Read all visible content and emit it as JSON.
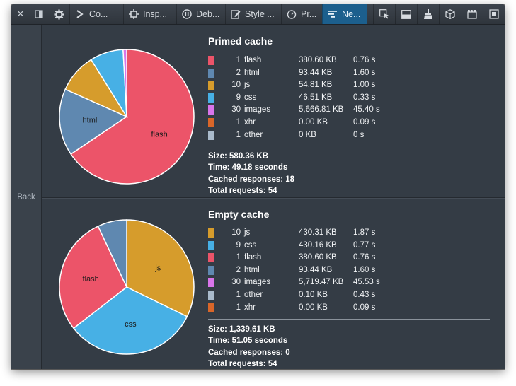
{
  "toolbar": {
    "tabs": [
      {
        "label": "Co...",
        "icon": "console-icon"
      },
      {
        "label": "Insp...",
        "icon": "inspector-icon"
      },
      {
        "label": "Deb...",
        "icon": "debugger-icon"
      },
      {
        "label": "Style ...",
        "icon": "style-editor-icon"
      },
      {
        "label": "Pr...",
        "icon": "profiler-icon"
      },
      {
        "label": "Ne...",
        "icon": "network-icon"
      }
    ]
  },
  "sidebar": {
    "back_label": "Back"
  },
  "primed": {
    "title": "Primed cache",
    "rows": [
      {
        "count": "1",
        "type": "flash",
        "size": "380.60 KB",
        "time": "0.76 s",
        "color": "#ec5469"
      },
      {
        "count": "2",
        "type": "html",
        "size": "93.44 KB",
        "time": "1.60 s",
        "color": "#5f88b0"
      },
      {
        "count": "10",
        "type": "js",
        "size": "54.81 KB",
        "time": "1.00 s",
        "color": "#d69c2c"
      },
      {
        "count": "9",
        "type": "css",
        "size": "46.51 KB",
        "time": "0.33 s",
        "color": "#47b0e5"
      },
      {
        "count": "30",
        "type": "images",
        "size": "5,666.81 KB",
        "time": "45.40 s",
        "color": "#d975ea"
      },
      {
        "count": "1",
        "type": "xhr",
        "size": "0.00 KB",
        "time": "0.09 s",
        "color": "#d96629"
      },
      {
        "count": "1",
        "type": "other",
        "size": "0 KB",
        "time": "0 s",
        "color": "#a9bacb"
      }
    ],
    "summary": {
      "size": "Size: 580.36 KB",
      "time": "Time: 49.18 seconds",
      "cached": "Cached responses: 18",
      "total": "Total requests: 54"
    }
  },
  "empty": {
    "title": "Empty cache",
    "rows": [
      {
        "count": "10",
        "type": "js",
        "size": "430.31 KB",
        "time": "1.87 s",
        "color": "#d69c2c"
      },
      {
        "count": "9",
        "type": "css",
        "size": "430.16 KB",
        "time": "0.77 s",
        "color": "#47b0e5"
      },
      {
        "count": "1",
        "type": "flash",
        "size": "380.60 KB",
        "time": "0.76 s",
        "color": "#ec5469"
      },
      {
        "count": "2",
        "type": "html",
        "size": "93.44 KB",
        "time": "1.60 s",
        "color": "#5f88b0"
      },
      {
        "count": "30",
        "type": "images",
        "size": "5,719.47 KB",
        "time": "45.53 s",
        "color": "#d975ea"
      },
      {
        "count": "1",
        "type": "other",
        "size": "0.10 KB",
        "time": "0.43 s",
        "color": "#a9bacb"
      },
      {
        "count": "1",
        "type": "xhr",
        "size": "0.00 KB",
        "time": "0.09 s",
        "color": "#d96629"
      }
    ],
    "summary": {
      "size": "Size: 1,339.61 KB",
      "time": "Time: 51.05 seconds",
      "cached": "Cached responses: 0",
      "total": "Total requests: 54"
    }
  },
  "chart_data": [
    {
      "type": "pie",
      "categories": [
        "flash",
        "html",
        "js",
        "css",
        "images"
      ],
      "values": [
        380.6,
        93.44,
        54.81,
        46.51,
        5.0
      ],
      "labels_shown": [
        "flash",
        "html"
      ]
    },
    {
      "type": "pie",
      "categories": [
        "js",
        "css",
        "flash",
        "html"
      ],
      "values": [
        430.31,
        430.16,
        380.6,
        93.44
      ],
      "labels_shown": [
        "js",
        "css",
        "flash"
      ]
    }
  ]
}
